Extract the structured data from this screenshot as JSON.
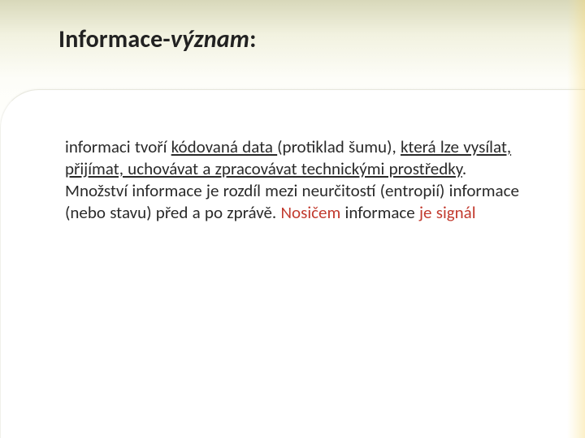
{
  "title": {
    "prefix": "Informace-",
    "italic": "význam",
    "suffix": ":"
  },
  "body": {
    "lead": "informaci tvoří ",
    "u1": "kódovaná data ",
    "mid1": "(protiklad šumu), ",
    "u2": "která lze vysílat, přijímat, uchovávat a zpracovávat technickými prostředky",
    "mid2": ". Množství informace je rozdíl mezi neurčitostí (entropií) informace (nebo stavu) před a po zprávě. ",
    "red1": "Nosičem ",
    "plain_after_red1": "informace ",
    "red2": "je signál"
  }
}
